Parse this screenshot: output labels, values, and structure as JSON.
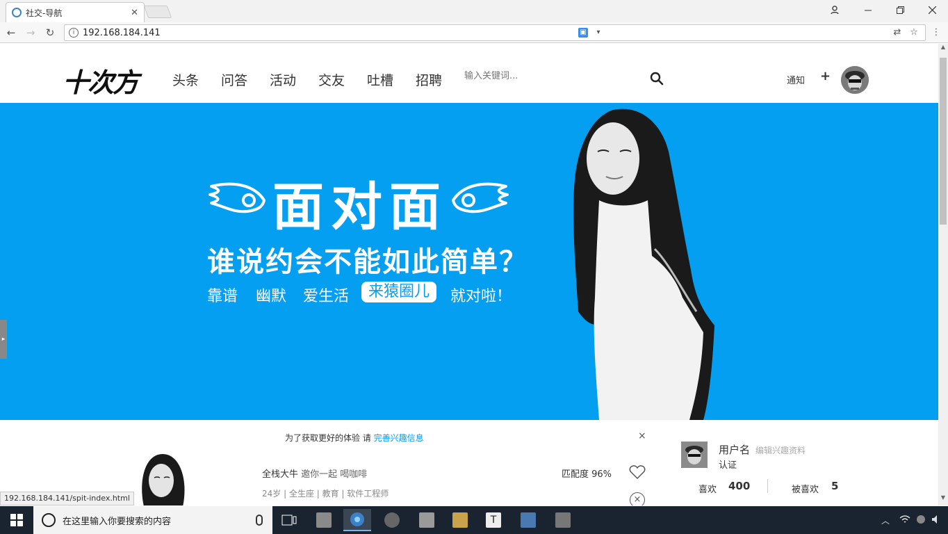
{
  "browser": {
    "tab_title": "社交-导航",
    "tab_close": "✕",
    "url": "192.168.184.141",
    "status_url": "192.168.184.141/spit-index.html"
  },
  "site": {
    "logo": "十次方",
    "nav": [
      "头条",
      "问答",
      "活动",
      "交友",
      "吐槽",
      "招聘"
    ],
    "search_placeholder": "输入关键词...",
    "notify": "通知",
    "plus": "+"
  },
  "banner": {
    "title": "面对面",
    "subtitle": "谁说约会不能如此简单？",
    "tags": [
      "靠谱",
      "幽默",
      "爱生活"
    ],
    "pill": "来猿圈儿",
    "tail": "就对啦！",
    "bg_color": "#049ff1"
  },
  "tip": {
    "text": "为了获取更好的体验 请",
    "link": "完善兴趣信息",
    "close": "×"
  },
  "card": {
    "name": "全栈大牛",
    "invite": "邀你一起 喝咖啡",
    "meta": "24岁 | 全生座 | 教育 | 软件工程师",
    "match": "匹配度 96%"
  },
  "user": {
    "name": "用户名",
    "edit": "编辑兴趣资料",
    "verify": "认证",
    "likes_label": "喜欢",
    "likes": "400",
    "liked_label": "被喜欢",
    "liked": "5"
  },
  "taskbar": {
    "search_placeholder": "在这里输入你要搜索的内容"
  }
}
